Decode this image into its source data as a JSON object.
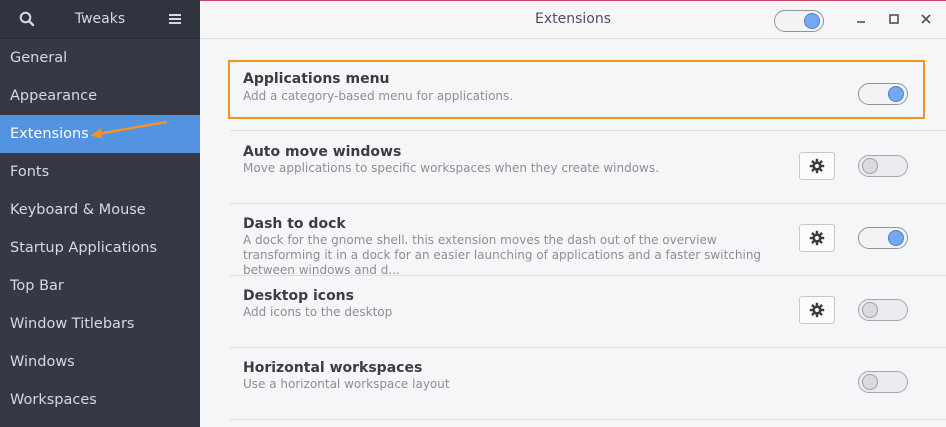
{
  "sidebar": {
    "title": "Tweaks",
    "items": [
      {
        "label": "General"
      },
      {
        "label": "Appearance"
      },
      {
        "label": "Extensions"
      },
      {
        "label": "Fonts"
      },
      {
        "label": "Keyboard & Mouse"
      },
      {
        "label": "Startup Applications"
      },
      {
        "label": "Top Bar"
      },
      {
        "label": "Window Titlebars"
      },
      {
        "label": "Windows"
      },
      {
        "label": "Workspaces"
      }
    ],
    "active_item": "Extensions"
  },
  "header": {
    "title": "Extensions",
    "master_switch": "on"
  },
  "extensions": [
    {
      "name": "Applications menu",
      "description": "Add a category-based menu for applications.",
      "enabled": true,
      "has_settings": false
    },
    {
      "name": "Auto move windows",
      "description": "Move applications to specific workspaces when they create windows.",
      "enabled": false,
      "has_settings": true
    },
    {
      "name": "Dash to dock",
      "description": "A dock for the gnome shell. this extension moves the dash out of the overview transforming it in a dock for an easier launching of applications and a faster switching between windows and d...",
      "enabled": true,
      "has_settings": true
    },
    {
      "name": "Desktop icons",
      "description": "Add icons to the desktop",
      "enabled": false,
      "has_settings": true
    },
    {
      "name": "Horizontal workspaces",
      "description": "Use a horizontal workspace layout",
      "enabled": false,
      "has_settings": false
    }
  ],
  "colors": {
    "sidebar_bg": "#353945",
    "accent": "#5294e2",
    "highlight_border": "#f39324",
    "annotation_arrow": "#f39324"
  }
}
